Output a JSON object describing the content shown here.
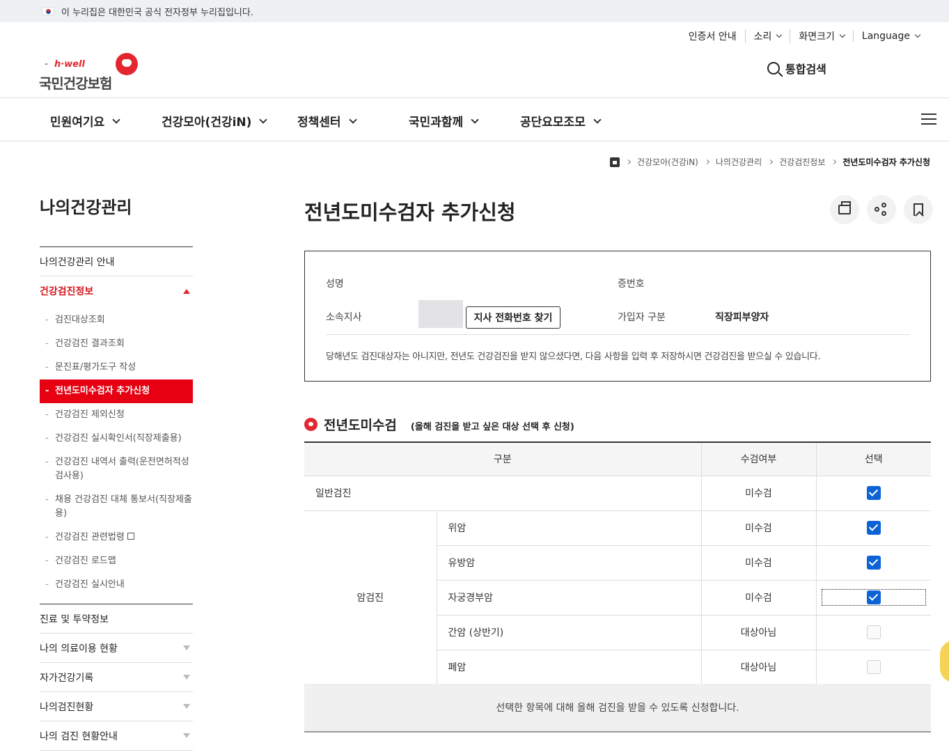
{
  "gov_banner": {
    "text": "이 누리집은 대한민국 공식 전자정부 누리집입니다."
  },
  "util_menu": [
    {
      "label": "인증서 안내",
      "has_dropdown": false
    },
    {
      "label": "소리",
      "has_dropdown": true
    },
    {
      "label": "화면크기",
      "has_dropdown": true
    },
    {
      "label": "Language",
      "has_dropdown": true
    }
  ],
  "logo": {
    "sub": "h·well",
    "main": "국민건강보험"
  },
  "search": {
    "label": "통합검색"
  },
  "gnb": [
    "민원여기요",
    "건강모아(건강iN)",
    "정책센터",
    "국민과함께",
    "공단요모조모"
  ],
  "breadcrumb": [
    "건강모아(건강iN)",
    "나의건강관리",
    "건강검진정보",
    "전년도미수검자 추가신청"
  ],
  "lnb": {
    "title": "나의건강관리",
    "intro": "나의건강관리 안내",
    "active_section": "건강검진정보",
    "sub_items": [
      "검진대상조회",
      "건강검진 결과조회",
      "문진표/평가도구 작성",
      "전년도미수검자 추가신청",
      "건강검진 제외신청",
      "건강검진 실시확인서(직장제출용)",
      "건강검진 내역서 출력(운전면허적성검사용)",
      "채용 건강검진 대체 통보서(직장제출용)",
      "건강검진 관련법령",
      "건강검진 로드맵",
      "건강검진 실시안내"
    ],
    "sections": [
      "진료 및 투약정보",
      "나의 의료이용 현황",
      "자가건강기록",
      "나의검진현황",
      "나의 검진 현황안내"
    ]
  },
  "page": {
    "title": "전년도미수검자 추가신청"
  },
  "info": {
    "name_label": "성명",
    "cert_label": "증번호",
    "branch_label": "소속지사",
    "branch_button": "지사 전화번호 찾기",
    "type_label": "가입자 구분",
    "type_value": "직장피부양자",
    "note": "당해년도 검진대상자는 아니지만, 전년도 건강검진을 받지 않으셨다면, 다음 사항을 입력 후 저장하시면 건강검진을 받으실 수 있습니다."
  },
  "section": {
    "title": "전년도미수검",
    "subtitle": "(올해 검진을 받고 싶은 대상 선택 후 신청)"
  },
  "table": {
    "headers": [
      "구분",
      "수검여부",
      "선택"
    ],
    "general": {
      "label": "일반검진",
      "status": "미수검",
      "checked": true
    },
    "cancer_label": "암검진",
    "cancer_rows": [
      {
        "label": "위암",
        "status": "미수검",
        "checked": true
      },
      {
        "label": "유방암",
        "status": "미수검",
        "checked": true
      },
      {
        "label": "자궁경부암",
        "status": "미수검",
        "checked": true
      },
      {
        "label": "간암 (상반기)",
        "status": "대상아님",
        "checked": false
      },
      {
        "label": "폐암",
        "status": "대상아님",
        "checked": false
      }
    ],
    "footer": "선택한 항목에 대해 올해 검진을 받을 수 있도록 신청합니다."
  },
  "colors": {
    "accent": "#e3262f",
    "active_menu_bg": "#e60012",
    "checkbox": "#0b63d6"
  }
}
